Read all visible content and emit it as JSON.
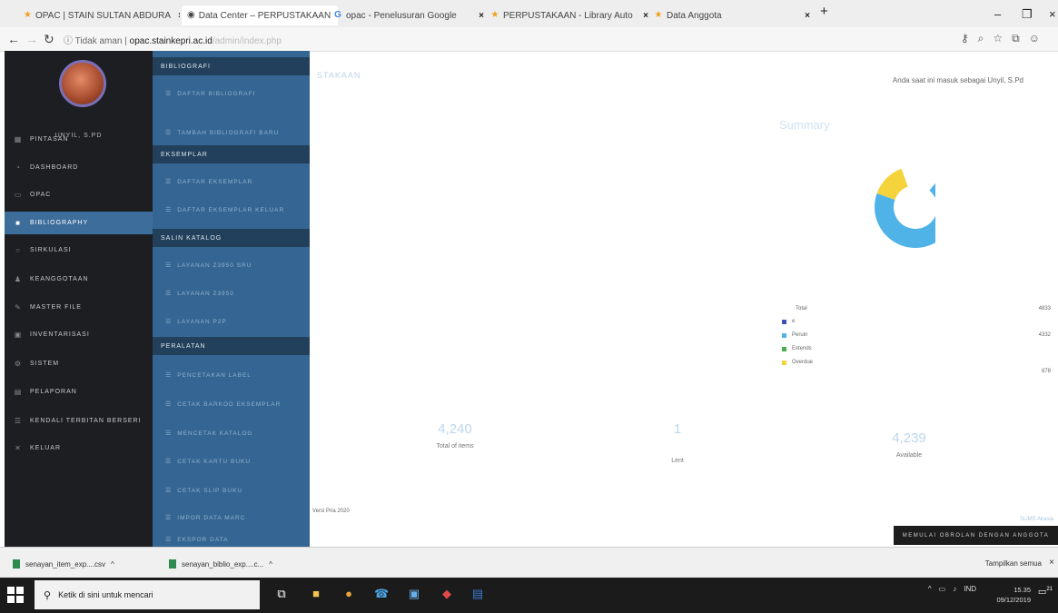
{
  "browser": {
    "tabs": [
      {
        "title": "OPAC | STAIN SULTAN ABDURA",
        "icon": "star-icon",
        "color": "#f0a020"
      },
      {
        "title": "Data Center – PERPUSTAKAAN",
        "icon": "globe-icon",
        "color": "#333333"
      },
      {
        "title": "opac - Penelusuran Google",
        "icon": "google-icon",
        "color": "#4285f4"
      },
      {
        "title": "PERPUSTAKAAN - Library Auto",
        "icon": "star-icon",
        "color": "#f0a020"
      },
      {
        "title": "Data Anggota",
        "icon": "star-icon",
        "color": "#f0a020"
      }
    ],
    "tab_close": "×",
    "new_tab": "+",
    "security_label": "Tidak aman",
    "url_host": "opac.stainkepri.ac.id",
    "url_path": "/admin/index.php"
  },
  "sidebar": {
    "username": "UNYIL, S.PD",
    "items": [
      {
        "label": "PINTASAN",
        "icon": "grid-icon"
      },
      {
        "label": "DASHBOARD",
        "icon": "dashboard-icon"
      },
      {
        "label": "OPAC",
        "icon": "monitor-icon"
      },
      {
        "label": "BIBLIOGRAPHY",
        "icon": "bookmark-icon"
      },
      {
        "label": "SIRKULASI",
        "icon": "circle-icon"
      },
      {
        "label": "KEANGGOTAAN",
        "icon": "user-icon"
      },
      {
        "label": "MASTER FILE",
        "icon": "pencil-icon"
      },
      {
        "label": "INVENTARISASI",
        "icon": "box-icon"
      },
      {
        "label": "SISTEM",
        "icon": "gear-icon"
      },
      {
        "label": "PELAPORAN",
        "icon": "chart-icon"
      },
      {
        "label": "KENDALI TERBITAN BERSERI",
        "icon": "list-icon"
      },
      {
        "label": "KELUAR",
        "icon": "close-icon"
      }
    ]
  },
  "submenu": {
    "sections": [
      {
        "head": "BIBLIOGRAFI",
        "items": [
          "DAFTAR BIBLIOGRAFI",
          "TAMBAH BIBLIOGRAFI BARU"
        ]
      },
      {
        "head": "EKSEMPLAR",
        "items": [
          "DAFTAR EKSEMPLAR",
          "DAFTAR EKSEMPLAR KELUAR"
        ]
      },
      {
        "head": "SALIN KATALOG",
        "items": [
          "LAYANAN Z3950 SRU",
          "LAYANAN Z3950",
          "LAYANAN P2P"
        ]
      },
      {
        "head": "PERALATAN",
        "items": [
          "PENCETAKAN LABEL",
          "CETAK BARKOD EKSEMPLAR",
          "MENCETAK KATALOG",
          "CETAK KARTU BUKU",
          "CETAK SLIP BUKU",
          "IMPOR DATA MARC",
          "EKSPOR DATA"
        ]
      }
    ]
  },
  "main": {
    "page_title": "STAKAAN",
    "greeting": "Anda saat ini masuk sebagai Unyil, S.Pd",
    "summary_title": "Summary",
    "legend": {
      "title": "Total",
      "rows": [
        {
          "label": "e",
          "color": "#3f51b5",
          "value": ""
        },
        {
          "label": "Peruin",
          "color": "#4fb3e8",
          "value": "4332"
        },
        {
          "label": "Extends",
          "color": "#4caf50",
          "value": ""
        },
        {
          "label": "Overdue",
          "color": "#f5d33a",
          "value": "878"
        }
      ],
      "total_value": "4833"
    },
    "stats": [
      {
        "value": "4,240",
        "label": "Total of items"
      },
      {
        "value": "1",
        "label": "Lent"
      },
      {
        "value": "4,239",
        "label": "Available"
      }
    ],
    "footer_left": "Versi Pria 2020",
    "footer_right": "SLiMS Akasia",
    "news_banner": "MEMULAI OBROLAN DENGAN ANGGOTA"
  },
  "chart_data": {
    "type": "pie",
    "title": "Summary",
    "series": [
      {
        "name": "Peruin",
        "value": 4332,
        "color": "#4fb3e8"
      },
      {
        "name": "Overdue",
        "value": 878,
        "color": "#f5d33a"
      }
    ]
  },
  "downloads": {
    "files": [
      "senayan_item_exp....csv",
      "senayan_biblio_exp....c..."
    ],
    "show_all": "Tampilkan semua",
    "close": "×"
  },
  "taskbar": {
    "search_placeholder": "Ketik di sini untuk mencari",
    "lang": "IND",
    "time": "15.35",
    "date": "09/12/2019",
    "notif_count": "21"
  }
}
